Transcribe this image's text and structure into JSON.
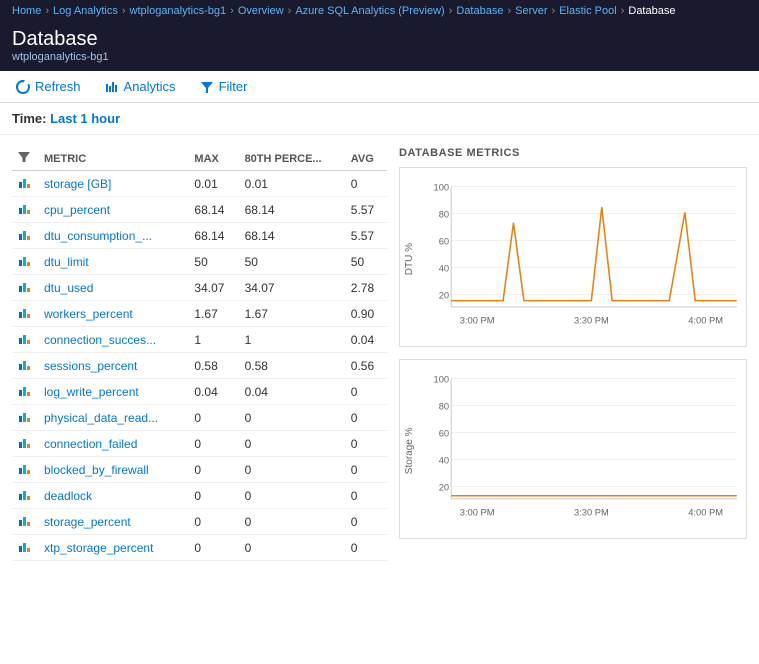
{
  "breadcrumb": {
    "items": [
      {
        "label": "Home",
        "active": false
      },
      {
        "label": "Log Analytics",
        "active": false
      },
      {
        "label": "wtploganalytics-bg1",
        "active": false
      },
      {
        "label": "Overview",
        "active": false
      },
      {
        "label": "Azure SQL Analytics (Preview)",
        "active": false
      },
      {
        "label": "Database",
        "active": false
      },
      {
        "label": "Server",
        "active": false
      },
      {
        "label": "Elastic Pool",
        "active": false
      },
      {
        "label": "Database",
        "active": true
      }
    ]
  },
  "header": {
    "title": "Database",
    "subtitle": "wtploganalytics-bg1"
  },
  "toolbar": {
    "refresh_label": "Refresh",
    "analytics_label": "Analytics",
    "filter_label": "Filter"
  },
  "time_bar": {
    "prefix": "Time:",
    "value": "Last 1 hour"
  },
  "table": {
    "columns": [
      "METRIC",
      "MAX",
      "80TH PERCE...",
      "AVG"
    ],
    "rows": [
      {
        "metric": "storage [GB]",
        "max": "0.01",
        "p80": "0.01",
        "avg": "0"
      },
      {
        "metric": "cpu_percent",
        "max": "68.14",
        "p80": "68.14",
        "avg": "5.57"
      },
      {
        "metric": "dtu_consumption_...",
        "max": "68.14",
        "p80": "68.14",
        "avg": "5.57"
      },
      {
        "metric": "dtu_limit",
        "max": "50",
        "p80": "50",
        "avg": "50"
      },
      {
        "metric": "dtu_used",
        "max": "34.07",
        "p80": "34.07",
        "avg": "2.78"
      },
      {
        "metric": "workers_percent",
        "max": "1.67",
        "p80": "1.67",
        "avg": "0.90"
      },
      {
        "metric": "connection_succes...",
        "max": "1",
        "p80": "1",
        "avg": "0.04"
      },
      {
        "metric": "sessions_percent",
        "max": "0.58",
        "p80": "0.58",
        "avg": "0.56"
      },
      {
        "metric": "log_write_percent",
        "max": "0.04",
        "p80": "0.04",
        "avg": "0"
      },
      {
        "metric": "physical_data_read...",
        "max": "0",
        "p80": "0",
        "avg": "0"
      },
      {
        "metric": "connection_failed",
        "max": "0",
        "p80": "0",
        "avg": "0"
      },
      {
        "metric": "blocked_by_firewall",
        "max": "0",
        "p80": "0",
        "avg": "0"
      },
      {
        "metric": "deadlock",
        "max": "0",
        "p80": "0",
        "avg": "0"
      },
      {
        "metric": "storage_percent",
        "max": "0",
        "p80": "0",
        "avg": "0"
      },
      {
        "metric": "xtp_storage_percent",
        "max": "0",
        "p80": "0",
        "avg": "0"
      }
    ]
  },
  "charts": {
    "title": "DATABASE METRICS",
    "dtu_chart": {
      "y_label": "DTU %",
      "y_ticks": [
        20,
        40,
        60,
        80,
        100
      ],
      "x_ticks": [
        "3:00 PM",
        "3:30 PM",
        "4:00 PM"
      ],
      "color": "#e8820c"
    },
    "storage_chart": {
      "y_label": "Storage %",
      "y_ticks": [
        20,
        40,
        60,
        80,
        100
      ],
      "x_ticks": [
        "3:00 PM",
        "3:30 PM",
        "4:00 PM"
      ],
      "color": "#e8820c"
    }
  }
}
